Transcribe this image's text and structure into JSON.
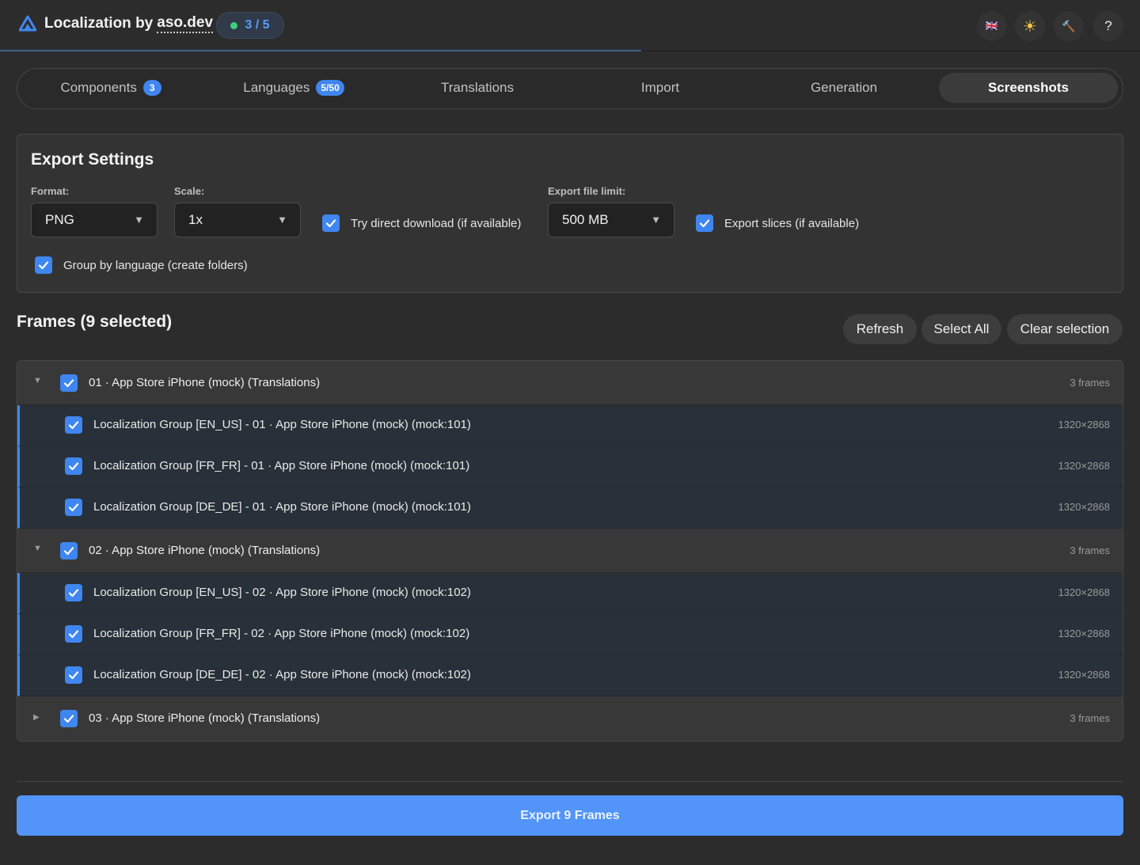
{
  "header": {
    "title": "Localization by",
    "link": "aso.dev",
    "step": "3 / 5",
    "language_flag": "🇬🇧",
    "theme_icon": "☀",
    "tool_icon": "🔨",
    "help": "?"
  },
  "tabs": [
    {
      "label": "Components",
      "badge": "3"
    },
    {
      "label": "Languages",
      "badge": "5/50"
    },
    {
      "label": "Translations"
    },
    {
      "label": "Import"
    },
    {
      "label": "Generation"
    },
    {
      "label": "Screenshots",
      "active": true
    }
  ],
  "export_settings": {
    "title": "Export Settings",
    "format_label": "Format:",
    "format_value": "PNG",
    "scale_label": "Scale:",
    "scale_value": "1x",
    "direct_download": "Try direct download (if available)",
    "file_limit_label": "Export file limit:",
    "file_limit_value": "500 MB",
    "export_slices": "Export slices (if available)",
    "group_by_language": "Group by language (create folders)"
  },
  "frames": {
    "title": "Frames (9 selected)",
    "refresh": "Refresh",
    "select_all": "Select All",
    "clear_selection": "Clear selection",
    "groups": [
      {
        "label": "01 · App Store iPhone (mock) (Translations)",
        "count": "3 frames",
        "expanded": true,
        "items": [
          {
            "label": "Localization Group [EN_US] - 01 · App Store iPhone (mock) (mock:101)",
            "size": "1320×2868"
          },
          {
            "label": "Localization Group [FR_FR] - 01 · App Store iPhone (mock) (mock:101)",
            "size": "1320×2868"
          },
          {
            "label": "Localization Group [DE_DE] - 01 · App Store iPhone (mock) (mock:101)",
            "size": "1320×2868"
          }
        ]
      },
      {
        "label": "02 · App Store iPhone (mock) (Translations)",
        "count": "3 frames",
        "expanded": true,
        "items": [
          {
            "label": "Localization Group [EN_US] - 02 · App Store iPhone (mock) (mock:102)",
            "size": "1320×2868"
          },
          {
            "label": "Localization Group [FR_FR] - 02 · App Store iPhone (mock) (mock:102)",
            "size": "1320×2868"
          },
          {
            "label": "Localization Group [DE_DE] - 02 · App Store iPhone (mock) (mock:102)",
            "size": "1320×2868"
          }
        ]
      },
      {
        "label": "03 · App Store iPhone (mock) (Translations)",
        "count": "3 frames",
        "expanded": false,
        "items": []
      }
    ]
  },
  "export_button": "Export 9 Frames",
  "colors": {
    "accent": "#3f86f0",
    "export_button": "#5294f7",
    "step_dot": "#3dd07a"
  }
}
